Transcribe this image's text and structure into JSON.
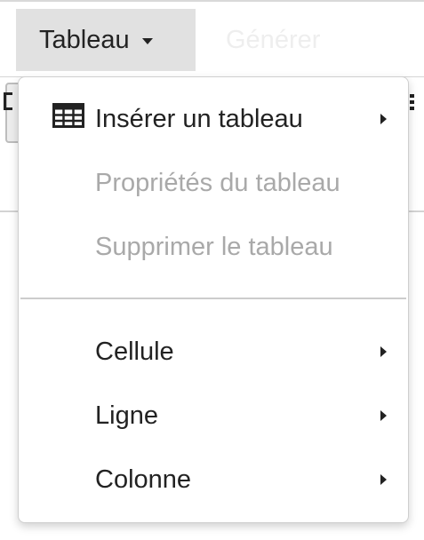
{
  "menubar": {
    "tableau_label": "Tableau",
    "ghost_label": "Générer"
  },
  "dropdown": {
    "items": [
      {
        "label": "Insérer un tableau",
        "icon": "table-icon",
        "submenu": true,
        "disabled": false
      },
      {
        "label": "Propriétés du tableau",
        "submenu": false,
        "disabled": true
      },
      {
        "label": "Supprimer le tableau",
        "submenu": false,
        "disabled": true
      },
      {
        "label": "Cellule",
        "submenu": true,
        "disabled": false
      },
      {
        "label": "Ligne",
        "submenu": true,
        "disabled": false
      },
      {
        "label": "Colonne",
        "submenu": true,
        "disabled": false
      }
    ]
  },
  "colors": {
    "menu_active_bg": "#e1e1e1",
    "text": "#222222",
    "disabled_text": "#a9a9a9",
    "separator": "#cccccc"
  }
}
